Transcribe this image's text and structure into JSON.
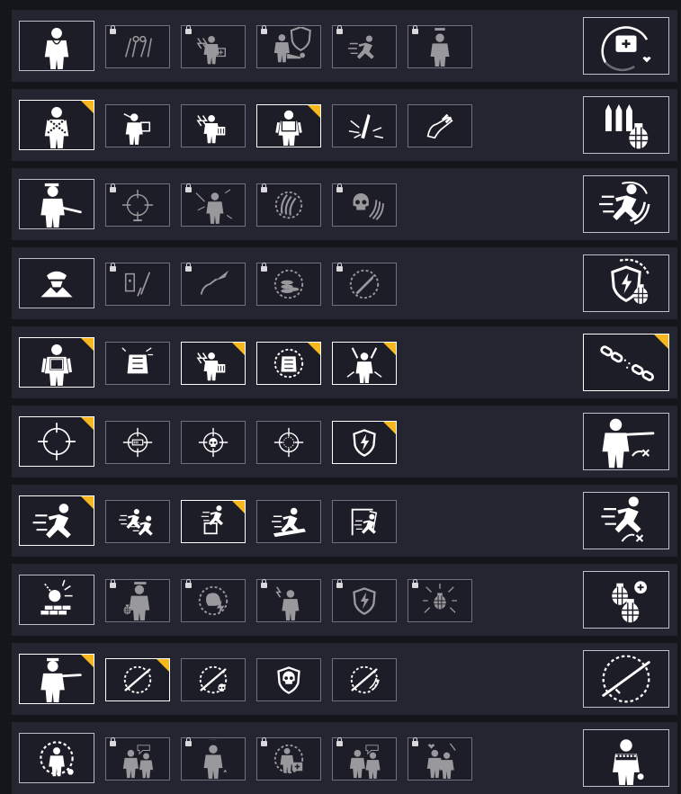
{
  "colors": {
    "background": "#15151c",
    "row": "#252532",
    "tile": "#1d1d27",
    "active_corner": "#f6b81e",
    "icon": "#ffffff"
  },
  "rows": [
    {
      "name": "medic",
      "main": {
        "icon": "medic-icon",
        "active": false
      },
      "perks": [
        {
          "icon": "surgical-tools-icon",
          "locked": true,
          "active": false
        },
        {
          "icon": "field-medkit-icon",
          "locked": true,
          "active": false
        },
        {
          "icon": "revive-soldier-icon",
          "locked": true,
          "active": false
        },
        {
          "icon": "sprint-slide-icon",
          "locked": true,
          "active": false
        },
        {
          "icon": "officer-icon",
          "locked": true,
          "active": false
        }
      ],
      "special": {
        "icon": "medkit-timer-icon",
        "active": false
      }
    },
    {
      "name": "support",
      "main": {
        "icon": "ammo-carrier-icon",
        "active": true
      },
      "perks": [
        {
          "icon": "ammo-throw-icon",
          "locked": false,
          "active": false
        },
        {
          "icon": "ammo-crate-icon",
          "locked": false,
          "active": false
        },
        {
          "icon": "armored-soldier-icon",
          "locked": false,
          "active": true
        },
        {
          "icon": "bullets-icon",
          "locked": false,
          "active": false
        },
        {
          "icon": "hand-ammo-icon",
          "locked": false,
          "active": false
        }
      ],
      "special": {
        "icon": "ammo-grenade-icon",
        "active": false
      }
    },
    {
      "name": "assault",
      "main": {
        "icon": "rifleman-icon",
        "active": false
      },
      "perks": [
        {
          "icon": "target-scope-icon",
          "locked": true,
          "active": false
        },
        {
          "icon": "suppressed-soldier-icon",
          "locked": true,
          "active": false
        },
        {
          "icon": "magazine-reload-icon",
          "locked": true,
          "active": false
        },
        {
          "icon": "skull-magazine-icon",
          "locked": true,
          "active": false
        }
      ],
      "special": {
        "icon": "sprint-reload-icon",
        "active": false
      }
    },
    {
      "name": "spy",
      "main": {
        "icon": "spy-icon",
        "active": false
      },
      "perks": [
        {
          "icon": "lockpick-icon",
          "locked": true,
          "active": false
        },
        {
          "icon": "knife-hand-icon",
          "locked": true,
          "active": false
        },
        {
          "icon": "coin-timer-icon",
          "locked": true,
          "active": false
        },
        {
          "icon": "knife-timer-icon",
          "locked": true,
          "active": false
        }
      ],
      "special": {
        "icon": "shield-grenade-icon",
        "active": false
      }
    },
    {
      "name": "engineer",
      "main": {
        "icon": "engineer-icon",
        "active": true
      },
      "perks": [
        {
          "icon": "vest-explosion-icon",
          "locked": false,
          "active": false
        },
        {
          "icon": "ammo-crate-icon",
          "locked": false,
          "active": true
        },
        {
          "icon": "vest-timer-icon",
          "locked": false,
          "active": true
        },
        {
          "icon": "cheer-soldier-icon",
          "locked": false,
          "active": true
        }
      ],
      "special": {
        "icon": "broken-chain-icon",
        "active": true
      }
    },
    {
      "name": "sniper",
      "main": {
        "icon": "crosshair-icon",
        "active": true
      },
      "perks": [
        {
          "icon": "crosshair-battery-icon",
          "locked": false,
          "active": false
        },
        {
          "icon": "crosshair-skull-icon",
          "locked": false,
          "active": false
        },
        {
          "icon": "crosshair-dotted-icon",
          "locked": false,
          "active": false
        },
        {
          "icon": "shield-lightning-icon",
          "locked": false,
          "active": true
        }
      ],
      "special": {
        "icon": "sniper-soldier-icon",
        "active": false
      }
    },
    {
      "name": "scout",
      "main": {
        "icon": "sprint-icon",
        "active": true
      },
      "perks": [
        {
          "icon": "tackle-icon",
          "locked": false,
          "active": false
        },
        {
          "icon": "box-vault-icon",
          "locked": false,
          "active": true
        },
        {
          "icon": "dive-icon",
          "locked": false,
          "active": false
        },
        {
          "icon": "door-breach-icon",
          "locked": false,
          "active": false
        }
      ],
      "special": {
        "icon": "sprint-disabled-icon",
        "active": false
      }
    },
    {
      "name": "demolition",
      "main": {
        "icon": "wrecking-ball-icon",
        "active": false
      },
      "perks": [
        {
          "icon": "grenadier-icon",
          "locked": true,
          "active": false
        },
        {
          "icon": "brain-timer-icon",
          "locked": true,
          "active": false
        },
        {
          "icon": "shocked-soldier-icon",
          "locked": true,
          "active": false
        },
        {
          "icon": "shield-bolt-icon",
          "locked": true,
          "active": false
        },
        {
          "icon": "grenade-blast-icon",
          "locked": true,
          "active": false
        }
      ],
      "special": {
        "icon": "double-grenade-icon",
        "active": false
      }
    },
    {
      "name": "shotgunner",
      "main": {
        "icon": "shotgunner-icon",
        "active": true
      },
      "perks": [
        {
          "icon": "shotgun-timer-icon",
          "locked": false,
          "active": true
        },
        {
          "icon": "shotgun-skull-icon",
          "locked": false,
          "active": false
        },
        {
          "icon": "skull-shield-icon",
          "locked": false,
          "active": false
        },
        {
          "icon": "shotgun-reload-icon",
          "locked": false,
          "active": false
        }
      ],
      "special": {
        "icon": "shotgun-ring-icon",
        "active": false
      }
    },
    {
      "name": "morale",
      "main": {
        "icon": "soldier-timer-icon",
        "active": false
      },
      "perks": [
        {
          "icon": "shouting-soldiers-icon",
          "locked": true,
          "active": false
        },
        {
          "icon": "decorated-soldier-icon",
          "locked": true,
          "active": false
        },
        {
          "icon": "soldier-medkit-icon",
          "locked": true,
          "active": false
        },
        {
          "icon": "argue-soldiers-icon",
          "locked": true,
          "active": false
        },
        {
          "icon": "heart-soldiers-icon",
          "locked": true,
          "active": false
        }
      ],
      "special": {
        "icon": "cold-soldier-icon",
        "active": false
      }
    }
  ]
}
